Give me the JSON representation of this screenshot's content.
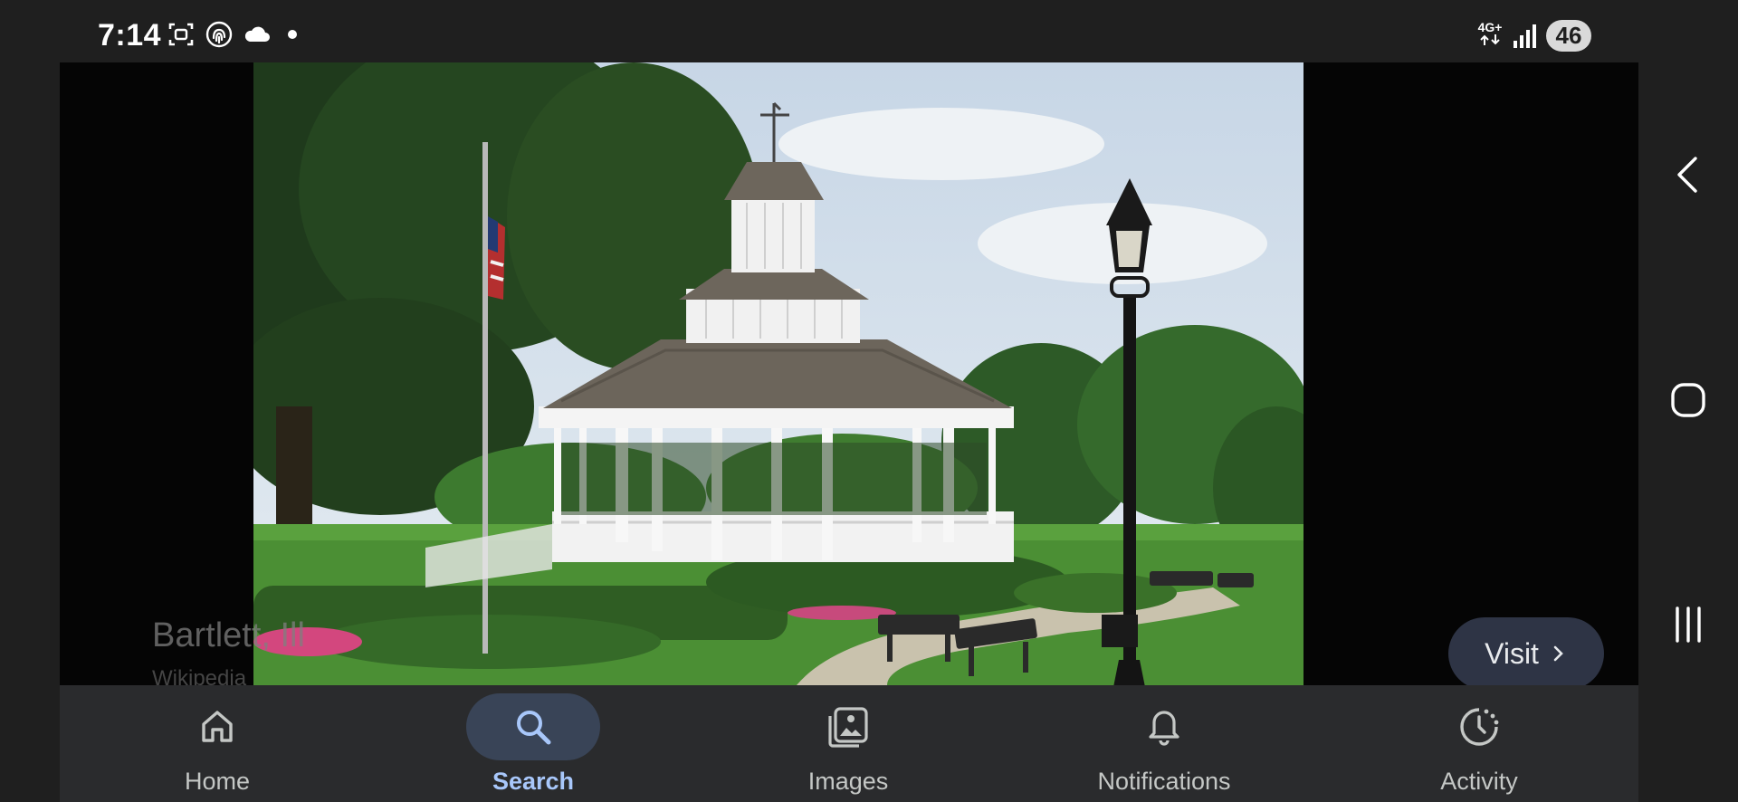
{
  "status_bar": {
    "time": "7:14",
    "left_icons": [
      "screenshot-icon",
      "fingerprint-icon",
      "cloud-icon",
      "notification-dot-icon"
    ],
    "network_type": "4G+",
    "battery": "46"
  },
  "viewer": {
    "image_alt": "Gazebo with flagpole and lamp post in a park",
    "caption_title": "Bartlett, Ill",
    "caption_source": "Wikipedia",
    "visit_label": "Visit"
  },
  "bottom_nav": {
    "items": [
      {
        "label": "Home",
        "icon": "home-icon"
      },
      {
        "label": "Search",
        "icon": "search-icon",
        "active": true
      },
      {
        "label": "Images",
        "icon": "images-icon"
      },
      {
        "label": "Notifications",
        "icon": "bell-icon"
      },
      {
        "label": "Activity",
        "icon": "activity-icon"
      }
    ]
  },
  "system_nav": [
    "back-icon",
    "home-circle-icon",
    "recents-icon"
  ],
  "colors": {
    "background": "#1f1f1f",
    "nav_bar": "#2a2b2d",
    "active_pill": "#394457",
    "active_label": "#a8c7fa",
    "visit_button": "#2e3445"
  }
}
